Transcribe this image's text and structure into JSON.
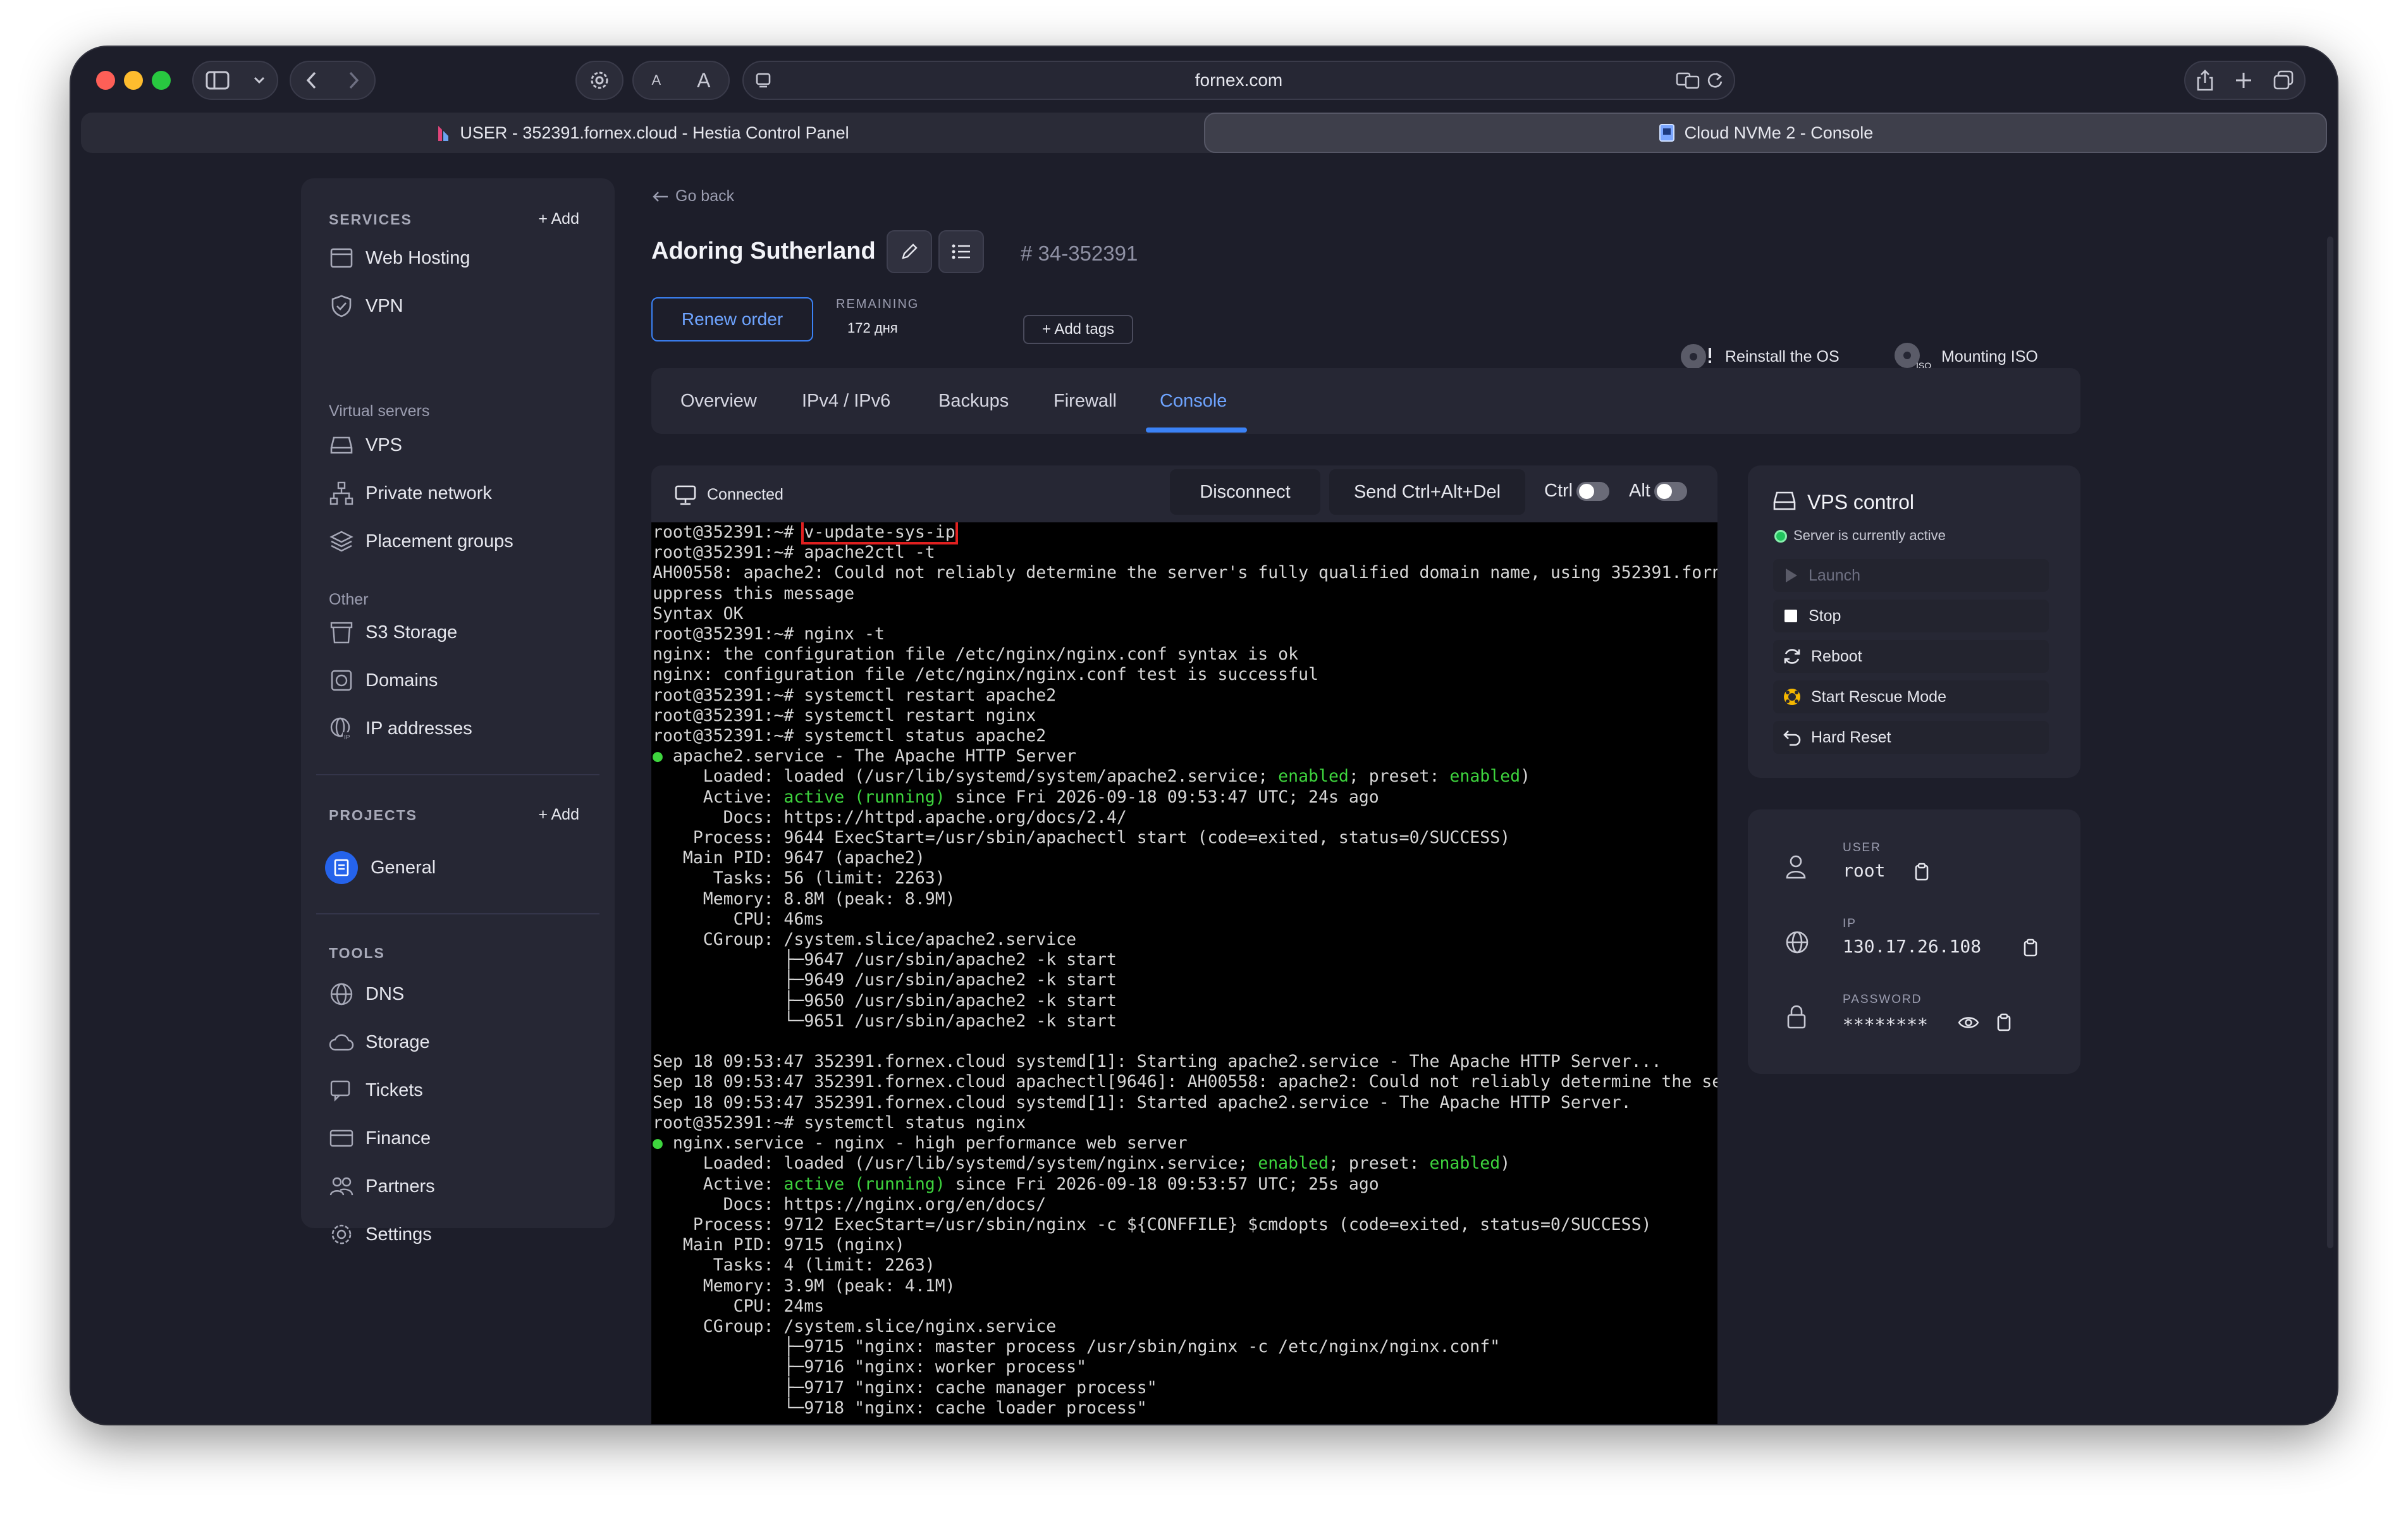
{
  "browser": {
    "url": "fornex.com",
    "tabs": [
      {
        "label": "USER - 352391.fornex.cloud - Hestia Control Panel"
      },
      {
        "label": "Cloud NVMe 2 - Console"
      }
    ],
    "font_small": "A",
    "font_large": "A"
  },
  "sidebar": {
    "services_title": "SERVICES",
    "services_add": "+ Add",
    "services": [
      {
        "label": "Web Hosting"
      },
      {
        "label": "VPN"
      }
    ],
    "virtual_title": "Virtual servers",
    "virtual": [
      {
        "label": "VPS"
      },
      {
        "label": "Private network"
      },
      {
        "label": "Placement groups"
      }
    ],
    "other_title": "Other",
    "other": [
      {
        "label": "S3 Storage"
      },
      {
        "label": "Domains"
      },
      {
        "label": "IP addresses"
      }
    ],
    "projects_title": "PROJECTS",
    "projects_add": "+ Add",
    "projects": [
      {
        "label": "General"
      }
    ],
    "tools_title": "TOOLS",
    "tools": [
      {
        "label": "DNS"
      },
      {
        "label": "Storage"
      },
      {
        "label": "Tickets"
      },
      {
        "label": "Finance"
      },
      {
        "label": "Partners"
      },
      {
        "label": "Settings"
      }
    ]
  },
  "header": {
    "go_back": "Go back",
    "server_name": "Adoring Sutherland",
    "server_id": "# 34-352391",
    "renew": "Renew order",
    "remaining_label": "REMAINING",
    "remaining_value": "172 дня",
    "add_tags": "+ Add tags",
    "reinstall": "Reinstall the OS",
    "mounting": "Mounting ISO",
    "iso_badge": "ISO"
  },
  "tabs": [
    {
      "label": "Overview"
    },
    {
      "label": "IPv4 / IPv6"
    },
    {
      "label": "Backups"
    },
    {
      "label": "Firewall"
    },
    {
      "label": "Console"
    }
  ],
  "console": {
    "status": "Connected",
    "disconnect": "Disconnect",
    "send_cad": "Send Ctrl+Alt+Del",
    "ctrl": "Ctrl",
    "alt": "Alt",
    "first_prompt": "root@352391:~# ",
    "first_command": "v-update-sys-ip",
    "lines": [
      [
        {
          "t": "root@352391:~# apache2ctl -t"
        }
      ],
      [
        {
          "t": "AH00558: apache2: Could not reliably determine the server's fully qualified domain name, using 352391.forn"
        }
      ],
      [
        {
          "t": "uppress this message"
        }
      ],
      [
        {
          "t": "Syntax OK"
        }
      ],
      [
        {
          "t": "root@352391:~# nginx -t"
        }
      ],
      [
        {
          "t": "nginx: the configuration file /etc/nginx/nginx.conf syntax is ok"
        }
      ],
      [
        {
          "t": "nginx: configuration file /etc/nginx/nginx.conf test is successful"
        }
      ],
      [
        {
          "t": "root@352391:~# systemctl restart apache2"
        }
      ],
      [
        {
          "t": "root@352391:~# systemctl restart nginx"
        }
      ],
      [
        {
          "t": "root@352391:~# systemctl status apache2"
        }
      ],
      [
        {
          "t": "●",
          "g": true
        },
        {
          "t": " apache2.service - The Apache HTTP Server"
        }
      ],
      [
        {
          "t": "     Loaded: loaded (/usr/lib/systemd/system/apache2.service; "
        },
        {
          "t": "enabled",
          "g": true
        },
        {
          "t": "; preset: "
        },
        {
          "t": "enabled",
          "g": true
        },
        {
          "t": ")"
        }
      ],
      [
        {
          "t": "     Active: "
        },
        {
          "t": "active (running)",
          "g": true
        },
        {
          "t": " since Fri 2026-09-18 09:53:47 UTC; 24s ago"
        }
      ],
      [
        {
          "t": "       Docs: https://httpd.apache.org/docs/2.4/"
        }
      ],
      [
        {
          "t": "    Process: 9644 ExecStart=/usr/sbin/apachectl start (code=exited, status=0/SUCCESS)"
        }
      ],
      [
        {
          "t": "   Main PID: 9647 (apache2)"
        }
      ],
      [
        {
          "t": "      Tasks: 56 (limit: 2263)"
        }
      ],
      [
        {
          "t": "     Memory: 8.8M (peak: 8.9M)"
        }
      ],
      [
        {
          "t": "        CPU: 46ms"
        }
      ],
      [
        {
          "t": "     CGroup: /system.slice/apache2.service"
        }
      ],
      [
        {
          "t": "             ├─9647 /usr/sbin/apache2 -k start"
        }
      ],
      [
        {
          "t": "             ├─9649 /usr/sbin/apache2 -k start"
        }
      ],
      [
        {
          "t": "             ├─9650 /usr/sbin/apache2 -k start"
        }
      ],
      [
        {
          "t": "             └─9651 /usr/sbin/apache2 -k start"
        }
      ],
      [
        {
          "t": ""
        }
      ],
      [
        {
          "t": "Sep 18 09:53:47 352391.fornex.cloud systemd[1]: Starting apache2.service - The Apache HTTP Server..."
        }
      ],
      [
        {
          "t": "Sep 18 09:53:47 352391.fornex.cloud apachectl[9646]: AH00558: apache2: Could not reliably determine the se"
        }
      ],
      [
        {
          "t": "Sep 18 09:53:47 352391.fornex.cloud systemd[1]: Started apache2.service - The Apache HTTP Server."
        }
      ],
      [
        {
          "t": "root@352391:~# systemctl status nginx"
        }
      ],
      [
        {
          "t": "●",
          "g": true
        },
        {
          "t": " nginx.service - nginx - high performance web server"
        }
      ],
      [
        {
          "t": "     Loaded: loaded (/usr/lib/systemd/system/nginx.service; "
        },
        {
          "t": "enabled",
          "g": true
        },
        {
          "t": "; preset: "
        },
        {
          "t": "enabled",
          "g": true
        },
        {
          "t": ")"
        }
      ],
      [
        {
          "t": "     Active: "
        },
        {
          "t": "active (running)",
          "g": true
        },
        {
          "t": " since Fri 2026-09-18 09:53:57 UTC; 25s ago"
        }
      ],
      [
        {
          "t": "       Docs: https://nginx.org/en/docs/"
        }
      ],
      [
        {
          "t": "    Process: 9712 ExecStart=/usr/sbin/nginx -c ${CONFFILE} $cmdopts (code=exited, status=0/SUCCESS)"
        }
      ],
      [
        {
          "t": "   Main PID: 9715 (nginx)"
        }
      ],
      [
        {
          "t": "      Tasks: 4 (limit: 2263)"
        }
      ],
      [
        {
          "t": "     Memory: 3.9M (peak: 4.1M)"
        }
      ],
      [
        {
          "t": "        CPU: 24ms"
        }
      ],
      [
        {
          "t": "     CGroup: /system.slice/nginx.service"
        }
      ],
      [
        {
          "t": "             ├─9715 \"nginx: master process /usr/sbin/nginx -c /etc/nginx/nginx.conf\""
        }
      ],
      [
        {
          "t": "             ├─9716 \"nginx: worker process\""
        }
      ],
      [
        {
          "t": "             ├─9717 \"nginx: cache manager process\""
        }
      ],
      [
        {
          "t": "             └─9718 \"nginx: cache loader process\""
        }
      ]
    ]
  },
  "vps_control": {
    "title": "VPS control",
    "status": "Server is currently active",
    "actions": [
      {
        "label": "Launch",
        "disabled": true
      },
      {
        "label": "Stop"
      },
      {
        "label": "Reboot"
      },
      {
        "label": "Start Rescue Mode"
      },
      {
        "label": "Hard Reset"
      }
    ]
  },
  "credentials": {
    "user_label": "USER",
    "user_value": "root",
    "ip_label": "IP",
    "ip_value": "130.17.26.108",
    "password_label": "PASSWORD",
    "password_value": "********"
  },
  "colors": {
    "accent": "#3b82f6",
    "terminal_green": "#3ed53e",
    "highlight_box": "#e02020",
    "status_active": "#22c55e"
  }
}
